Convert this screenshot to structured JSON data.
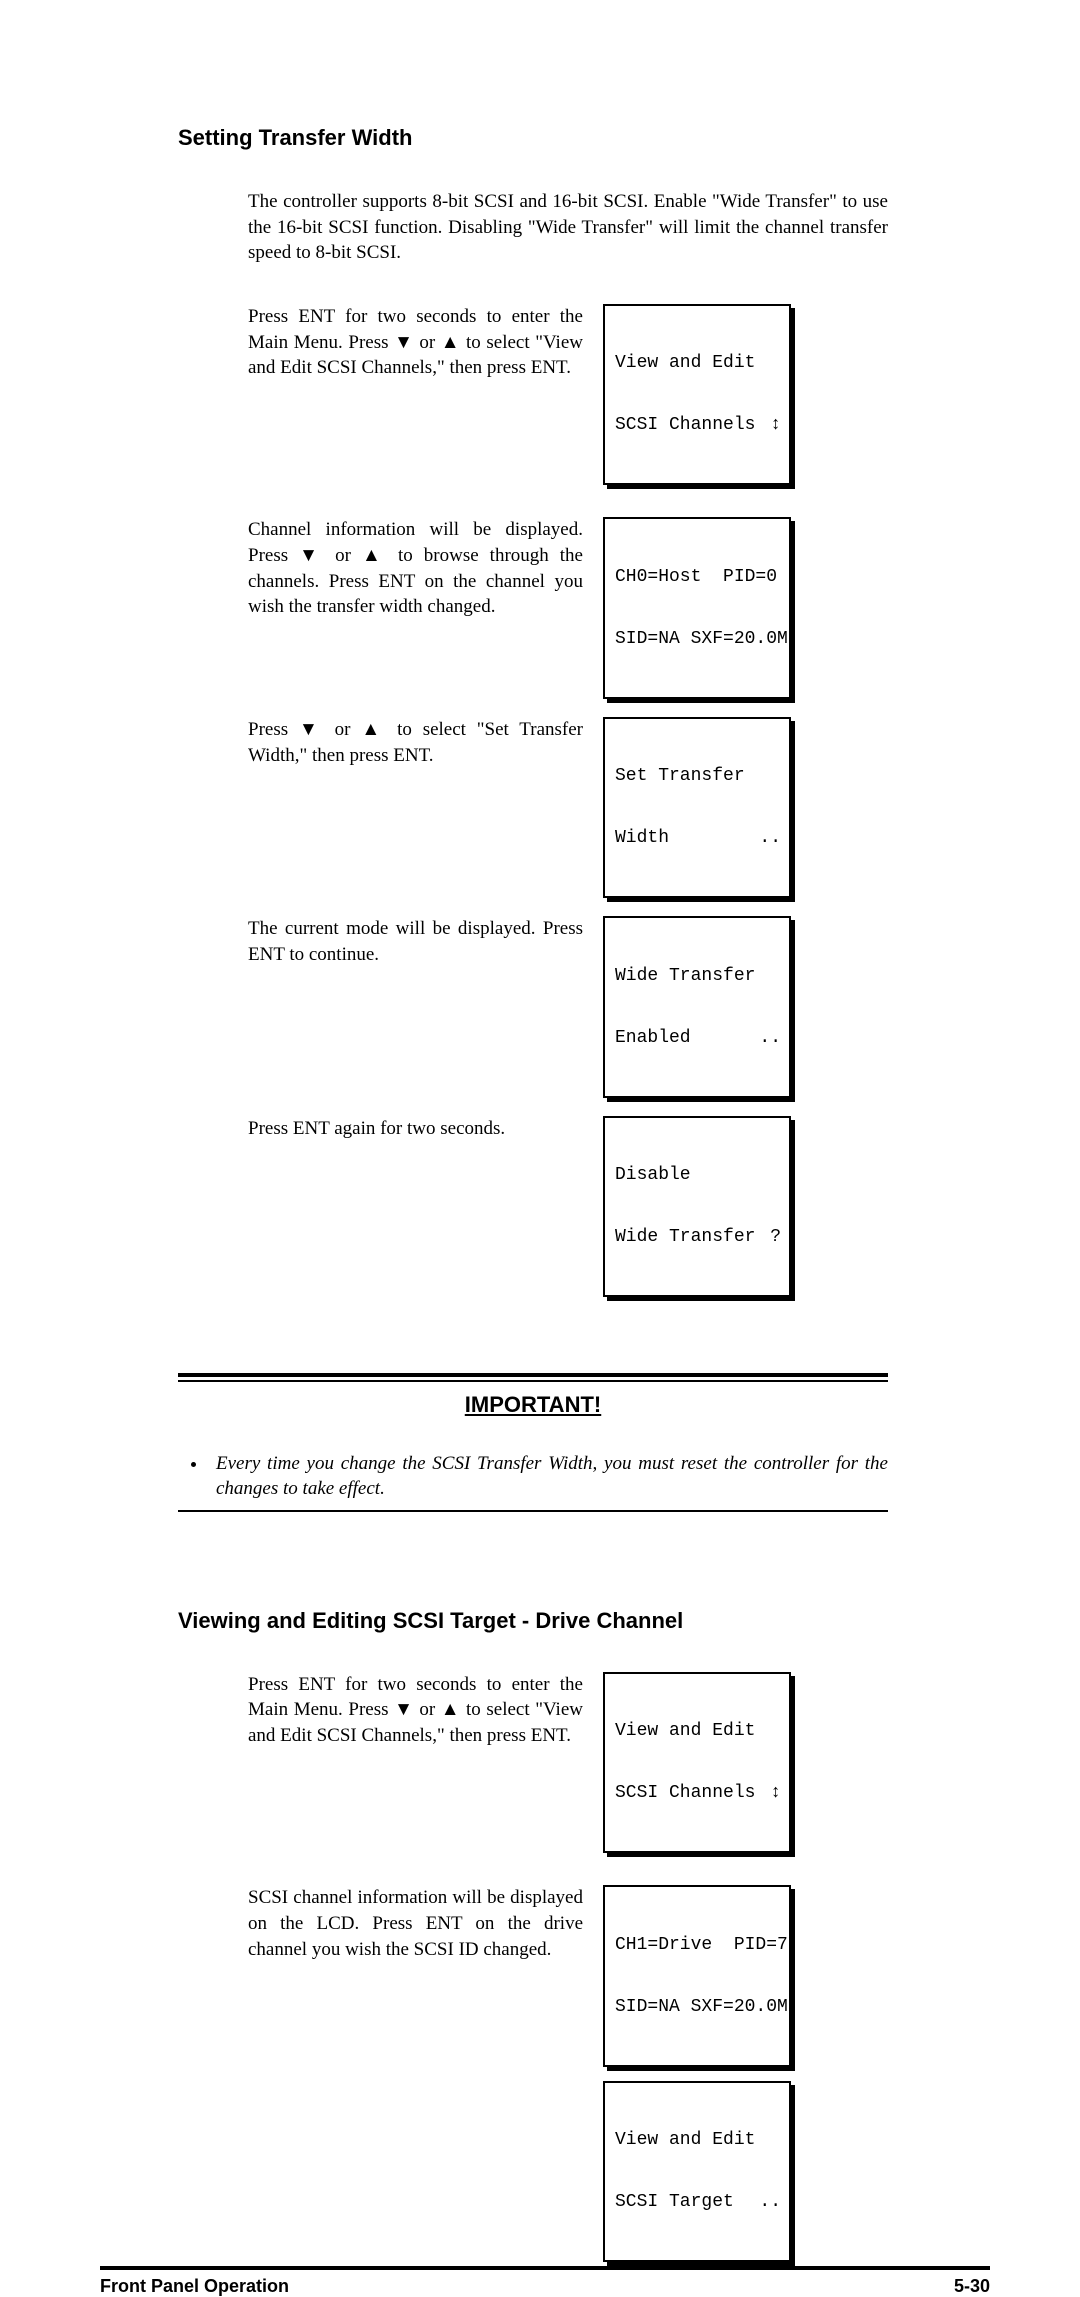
{
  "section1": {
    "heading": "Setting Transfer Width",
    "intro": "The controller supports 8-bit SCSI and 16-bit SCSI.  Enable \"Wide Transfer\" to use the 16-bit SCSI function. Disabling \"Wide Transfer\" will limit the channel transfer speed to 8-bit SCSI.",
    "steps": [
      {
        "text": "Press ENT for two seconds to enter the Main Menu.  Press ▼ or ▲ to select \"View and Edit SCSI Channels,\" then press ENT.",
        "lcd": {
          "l1": "View and Edit",
          "r1": "",
          "l2": "SCSI Channels",
          "r2": "↕"
        }
      },
      {
        "text": "Channel information will be displayed. Press ▼ or ▲ to browse through the channels. Press ENT on the channel you wish the transfer width changed.",
        "lcd": {
          "l1": "CH0=Host  PID=0",
          "r1": "",
          "l2": "SID=NA SXF=20.0M",
          "r2": ""
        }
      },
      {
        "text": "Press ▼ or ▲ to select \"Set Transfer Width,\" then press ENT.",
        "lcd": {
          "l1": "Set Transfer",
          "r1": "",
          "l2": "Width",
          "r2": ".."
        }
      },
      {
        "text": "The current mode will be displayed. Press ENT to continue.",
        "lcd": {
          "l1": "Wide Transfer",
          "r1": "",
          "l2": "Enabled",
          "r2": ".."
        }
      },
      {
        "text": "Press ENT again for two seconds.",
        "lcd": {
          "l1": "Disable",
          "r1": "",
          "l2": "Wide Transfer",
          "r2": "?"
        }
      }
    ]
  },
  "important": {
    "title": "IMPORTANT!",
    "bullet": "Every time you change the SCSI Transfer Width, you must reset the controller for the changes to take effect."
  },
  "section2": {
    "heading": "Viewing and Editing SCSI Target - Drive Channel",
    "steps": [
      {
        "text": "Press ENT for two seconds to enter the Main Menu.  Press ▼ or ▲ to select \"View and Edit SCSI Channels,\" then press ENT.",
        "lcd": {
          "l1": "View and Edit",
          "r1": "",
          "l2": "SCSI Channels",
          "r2": "↕"
        }
      },
      {
        "text": "SCSI channel information will be displayed on the LCD.  Press ENT on the drive channel you wish the SCSI ID changed.",
        "lcd": {
          "l1": "CH1=Drive  PID=7",
          "r1": "",
          "l2": "SID=NA SXF=20.0M",
          "r2": ""
        },
        "lcd2": {
          "l1": "View and Edit",
          "r1": "",
          "l2": "SCSI Target",
          "r2": ".."
        }
      }
    ]
  },
  "footer": {
    "left": "Front Panel Operation",
    "right": "5-30"
  }
}
